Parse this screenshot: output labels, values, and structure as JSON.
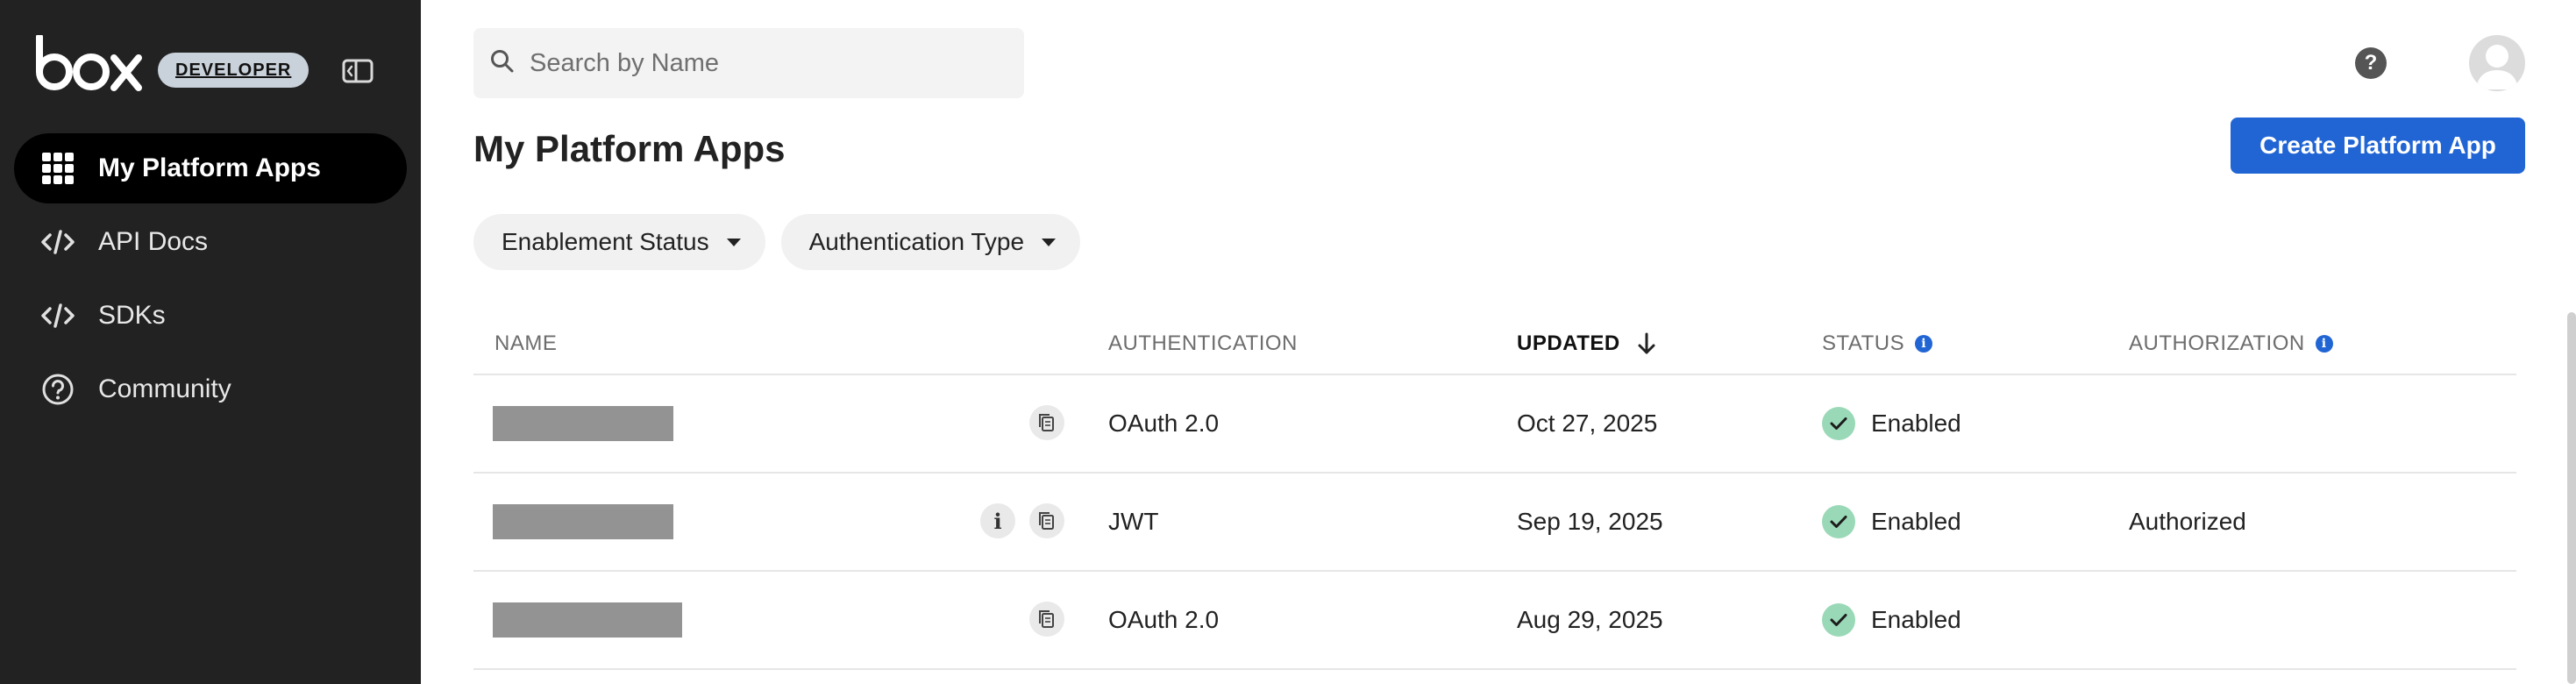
{
  "app": {
    "logo_text": "box",
    "badge": "DEVELOPER"
  },
  "sidebar": {
    "items": [
      {
        "label": "My Platform Apps",
        "icon": "grid-icon",
        "active": true
      },
      {
        "label": "API Docs",
        "icon": "code-icon",
        "active": false
      },
      {
        "label": "SDKs",
        "icon": "code-icon",
        "active": false
      },
      {
        "label": "Community",
        "icon": "help-circle-icon",
        "active": false
      }
    ]
  },
  "header": {
    "search_placeholder": "Search by Name",
    "help_icon": "question-icon",
    "avatar_icon": "user-icon"
  },
  "main": {
    "title": "My Platform Apps",
    "create_button": "Create Platform App",
    "filters": [
      "Enablement Status",
      "Authentication Type"
    ],
    "table": {
      "columns": {
        "name": "NAME",
        "authentication": "AUTHENTICATION",
        "updated": "UPDATED",
        "status": "STATUS",
        "authorization": "AUTHORIZATION"
      },
      "sort": {
        "column": "updated",
        "direction": "descending"
      },
      "rows": [
        {
          "name": "[redacted]",
          "authentication": "OAuth 2.0",
          "updated": "Oct 27, 2025",
          "status": "Enabled",
          "authorization": "",
          "has_info": false
        },
        {
          "name": "[redacted]",
          "authentication": "JWT",
          "updated": "Sep 19, 2025",
          "status": "Enabled",
          "authorization": "Authorized",
          "has_info": true
        },
        {
          "name": "[redacted]",
          "authentication": "OAuth 2.0",
          "updated": "Aug 29, 2025",
          "status": "Enabled",
          "authorization": "",
          "has_info": false
        }
      ]
    }
  },
  "colors": {
    "sidebar_bg": "#222222",
    "active_nav_bg": "#000000",
    "primary": "#2165d4",
    "status_enabled": "#9ad9b7",
    "redaction": "#939393"
  }
}
